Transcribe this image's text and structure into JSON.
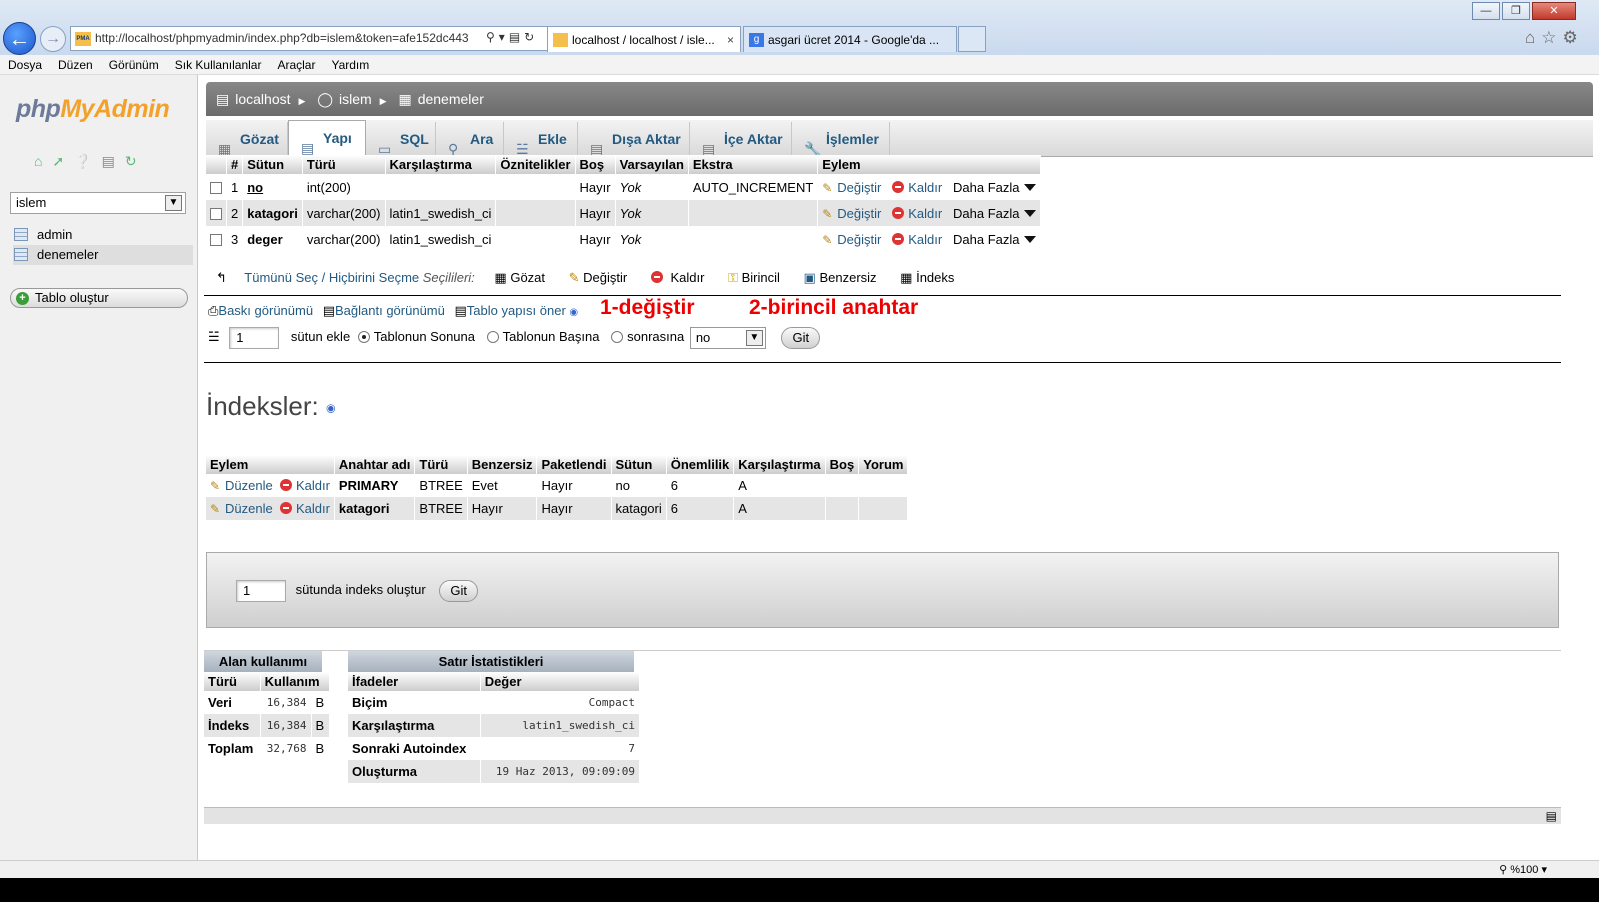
{
  "browser": {
    "address": "http://localhost/phpmyadmin/index.php?db=islem&token=afe152dc443",
    "tabs": [
      {
        "label": "localhost / localhost / isle...",
        "close": "×"
      },
      {
        "label": "asgari ücret 2014 - Google'da ..."
      }
    ],
    "menu": [
      "Dosya",
      "Düzen",
      "Görünüm",
      "Sık Kullanılanlar",
      "Araçlar",
      "Yardım"
    ],
    "zoom": "%100"
  },
  "sidebar": {
    "logo_a": "php",
    "logo_b": "MyAdmin",
    "db_select": "islem",
    "tables": [
      "admin",
      "denemeler"
    ],
    "create_table": "Tablo oluştur"
  },
  "breadcrumb": {
    "server": "localhost",
    "db": "islem",
    "table": "denemeler"
  },
  "tabs": [
    {
      "label": "Gözat",
      "icon": "browse-icon"
    },
    {
      "label": "Yapı",
      "icon": "structure-icon"
    },
    {
      "label": "SQL",
      "icon": "sql-icon"
    },
    {
      "label": "Ara",
      "icon": "search-icon"
    },
    {
      "label": "Ekle",
      "icon": "insert-icon"
    },
    {
      "label": "Dışa Aktar",
      "icon": "export-icon"
    },
    {
      "label": "İçe Aktar",
      "icon": "import-icon"
    },
    {
      "label": "İşlemler",
      "icon": "wrench-icon"
    }
  ],
  "structure": {
    "headers": [
      "#",
      "Sütun",
      "Türü",
      "Karşılaştırma",
      "Öznitelikler",
      "Boş",
      "Varsayılan",
      "Ekstra",
      "Eylem"
    ],
    "rows": [
      {
        "n": "1",
        "name": "no",
        "type": "int(200)",
        "coll": "",
        "attr": "",
        "null": "Hayır",
        "def": "Yok",
        "extra": "AUTO_INCREMENT"
      },
      {
        "n": "2",
        "name": "katagori",
        "type": "varchar(200)",
        "coll": "latin1_swedish_ci",
        "attr": "",
        "null": "Hayır",
        "def": "Yok",
        "extra": ""
      },
      {
        "n": "3",
        "name": "deger",
        "type": "varchar(200)",
        "coll": "latin1_swedish_ci",
        "attr": "",
        "null": "Hayır",
        "def": "Yok",
        "extra": ""
      }
    ],
    "actions": {
      "edit": "Değiştir",
      "drop": "Kaldır",
      "more": "Daha Fazla"
    }
  },
  "selection_bar": {
    "check_all": "Tümünü Seç / Hiçbirini Seçme",
    "with_selected": "Seçilileri:",
    "items": [
      "Gözat",
      "Değiştir",
      "Kaldır",
      "Birincil",
      "Benzersiz",
      "İndeks"
    ]
  },
  "links": {
    "print": "Baskı görünümü",
    "relation": "Bağlantı görünümü",
    "propose": "Tablo yapısı öner"
  },
  "annotations": [
    "1-değiştir",
    "2-birincil anahtar"
  ],
  "add_column": {
    "count": "1",
    "label": "sütun ekle",
    "opt_end": "Tablonun Sonuna",
    "opt_start": "Tablonun Başına",
    "opt_after": "sonrasına",
    "after_col": "no",
    "go": "Git"
  },
  "indexes": {
    "title": "İndeksler:",
    "headers": [
      "Eylem",
      "Anahtar adı",
      "Türü",
      "Benzersiz",
      "Paketlendi",
      "Sütun",
      "Önemlilik",
      "Karşılaştırma",
      "Boş",
      "Yorum"
    ],
    "edit": "Düzenle",
    "drop": "Kaldır",
    "rows": [
      {
        "key": "PRIMARY",
        "type": "BTREE",
        "unique": "Evet",
        "packed": "Hayır",
        "col": "no",
        "card": "6",
        "coll": "A",
        "null": "",
        "comment": ""
      },
      {
        "key": "katagori",
        "type": "BTREE",
        "unique": "Hayır",
        "packed": "Hayır",
        "col": "katagori",
        "card": "6",
        "coll": "A",
        "null": "",
        "comment": ""
      }
    ],
    "create_count": "1",
    "create_label": "sütunda indeks oluştur",
    "go": "Git"
  },
  "space_usage": {
    "caption": "Alan kullanımı",
    "headers": [
      "Türü",
      "Kullanım"
    ],
    "rows": [
      {
        "k": "Veri",
        "v": "16,384",
        "u": "B"
      },
      {
        "k": "İndeks",
        "v": "16,384",
        "u": "B"
      },
      {
        "k": "Toplam",
        "v": "32,768",
        "u": "B"
      }
    ]
  },
  "row_stats": {
    "caption": "Satır İstatistikleri",
    "headers": [
      "İfadeler",
      "Değer"
    ],
    "rows": [
      {
        "k": "Biçim",
        "v": "Compact"
      },
      {
        "k": "Karşılaştırma",
        "v": "latin1_swedish_ci"
      },
      {
        "k": "Sonraki Autoindex",
        "v": "7"
      },
      {
        "k": "Oluşturma",
        "v": "19 Haz 2013, 09:09:09"
      }
    ]
  }
}
